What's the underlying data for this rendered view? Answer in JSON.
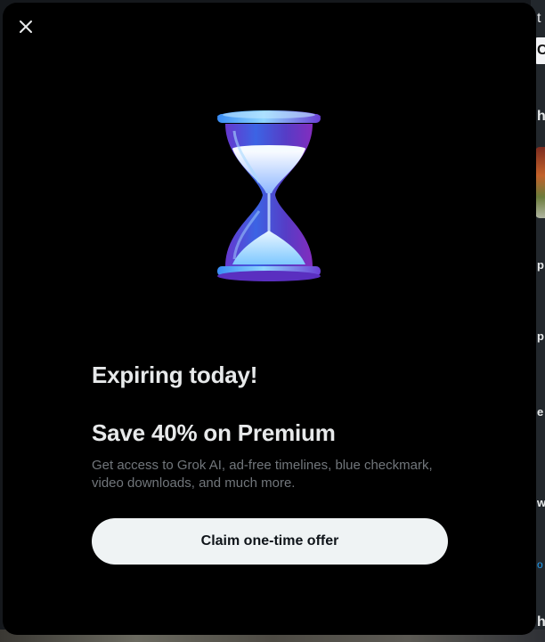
{
  "modal": {
    "close_icon": "close-icon",
    "illustration_icon": "hourglass-icon",
    "headline": "Expiring today!",
    "offer_title": "Save 40% on Premium",
    "description": "Get access to Grok AI, ad-free timelines, blue checkmark, video downloads, and much more.",
    "cta_label": "Claim one-time offer"
  },
  "background": {
    "fragments": {
      "top_t": "t",
      "card_c": "C",
      "h1": "h",
      "p": "p",
      "p2": "p",
      "e": "e",
      "w": "w",
      "h2": "h"
    }
  },
  "colors": {
    "modal_bg": "#000000",
    "text_primary": "#e7e9ea",
    "text_secondary": "#71767b",
    "cta_bg": "#eff3f4",
    "cta_text": "#0f1419",
    "accent_blue": "#1d9bf0"
  }
}
